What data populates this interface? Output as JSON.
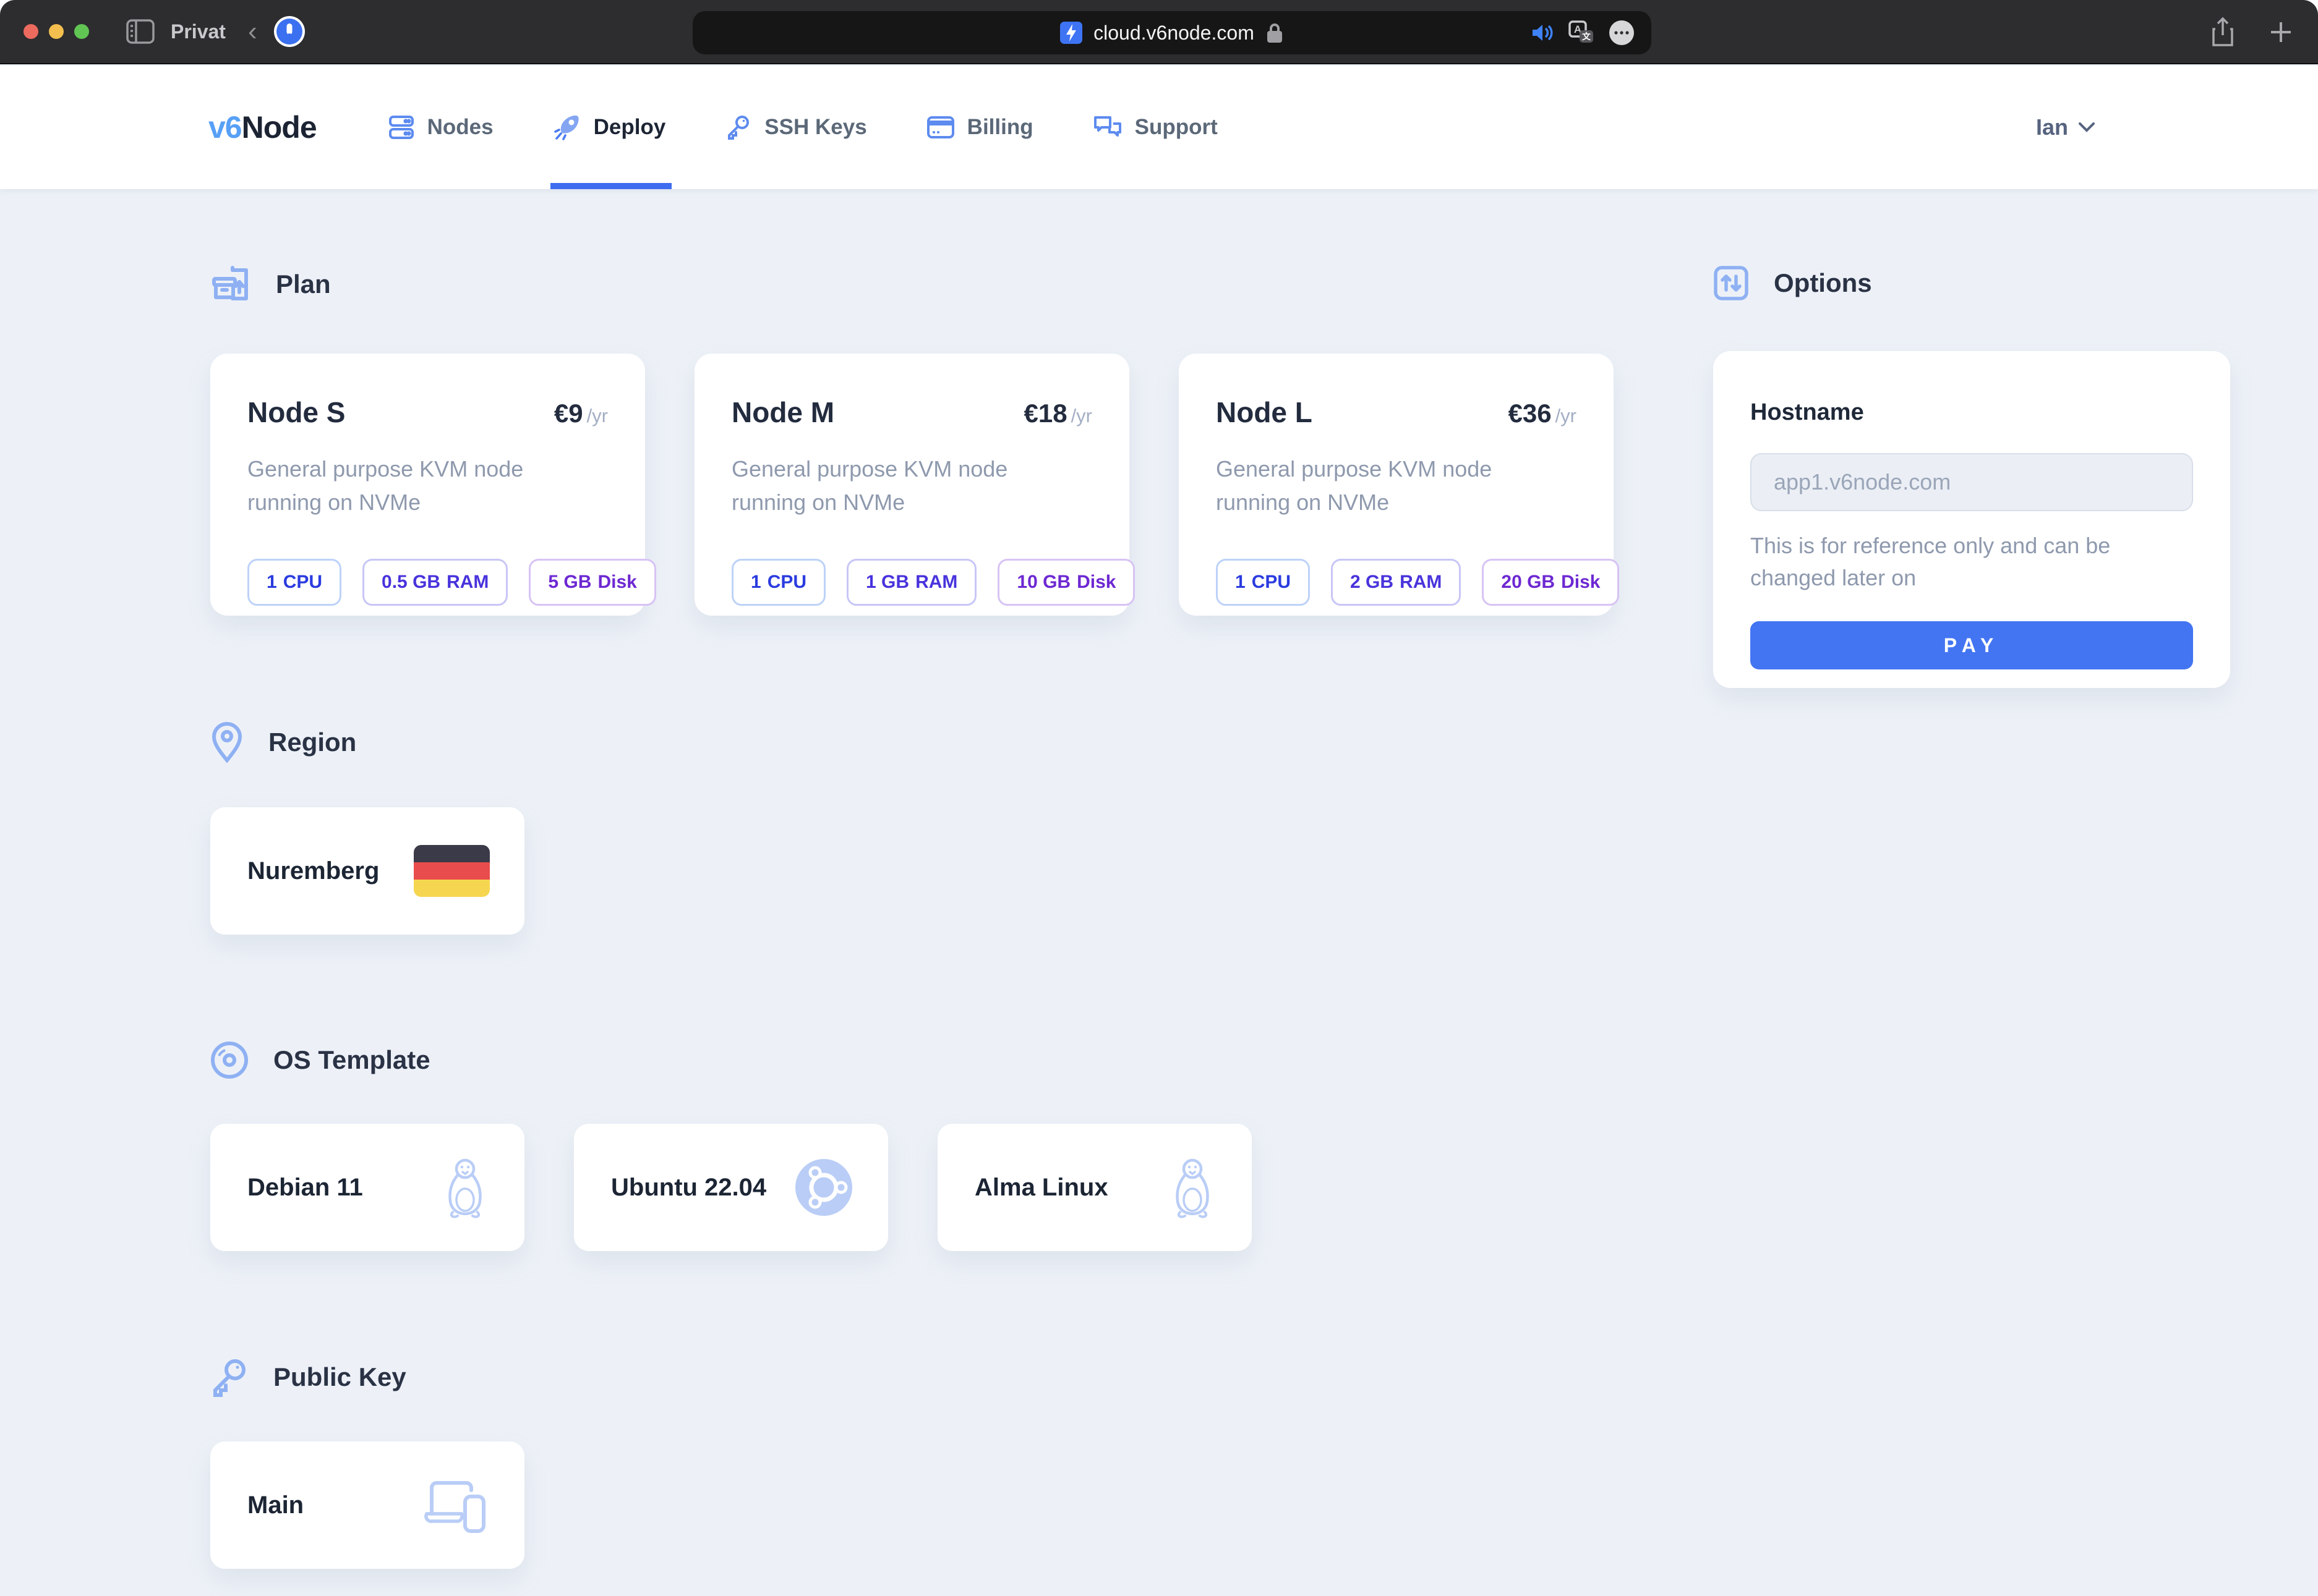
{
  "browser": {
    "window_label": "Privat",
    "url": "cloud.v6node.com",
    "icons": {
      "traffic_lights": "close / minimize / zoom",
      "sidebar_icon": "panel toggle",
      "back_icon": "‹",
      "onepassword_icon": "1Password extension",
      "favicon": "blue lightning bolt",
      "lock_icon": "padlock",
      "audio_icon": "speaker playing",
      "translate_icon": "translate bubble",
      "more_icon": "ellipsis circle",
      "share_icon": "share sheet",
      "new_tab_icon": "+"
    }
  },
  "nav": {
    "logo_prefix": "v6",
    "logo_suffix": "Node",
    "items": [
      {
        "label": "Nodes",
        "icon": "servers"
      },
      {
        "label": "Deploy",
        "icon": "rocket",
        "active": true
      },
      {
        "label": "SSH Keys",
        "icon": "key"
      },
      {
        "label": "Billing",
        "icon": "credit-card"
      },
      {
        "label": "Support",
        "icon": "chat-bubbles"
      }
    ],
    "user": {
      "name": "Ian",
      "icon": "chevron-down"
    }
  },
  "sections": {
    "plan": {
      "title": "Plan",
      "icon": "box-upload",
      "cards": [
        {
          "name": "Node S",
          "price": "€9",
          "period": "/yr",
          "description": "General purpose KVM node running on NVMe",
          "badges": [
            {
              "qty": "1",
              "unit": "CPU"
            },
            {
              "qty": "0.5 GB",
              "unit": "RAM"
            },
            {
              "qty": "5 GB",
              "unit": "Disk"
            }
          ]
        },
        {
          "name": "Node M",
          "price": "€18",
          "period": "/yr",
          "description": "General purpose KVM node running on NVMe",
          "badges": [
            {
              "qty": "1",
              "unit": "CPU"
            },
            {
              "qty": "1 GB",
              "unit": "RAM"
            },
            {
              "qty": "10 GB",
              "unit": "Disk"
            }
          ]
        },
        {
          "name": "Node L",
          "price": "€36",
          "period": "/yr",
          "description": "General purpose KVM node running on NVMe",
          "badges": [
            {
              "qty": "1",
              "unit": "CPU"
            },
            {
              "qty": "2 GB",
              "unit": "RAM"
            },
            {
              "qty": "20 GB",
              "unit": "Disk"
            }
          ]
        }
      ]
    },
    "options": {
      "title": "Options",
      "icon": "sliders",
      "hostname_label": "Hostname",
      "hostname_placeholder": "app1.v6node.com",
      "helper": "This is for reference only and can be changed later on",
      "pay_label": "PAY"
    },
    "region": {
      "title": "Region",
      "icon": "map-pin",
      "locations": [
        {
          "name": "Nuremberg",
          "flag": "germany"
        }
      ]
    },
    "os_template": {
      "title": "OS Template",
      "icon": "disc",
      "templates": [
        {
          "name": "Debian 11",
          "icon": "tux"
        },
        {
          "name": "Ubuntu 22.04",
          "icon": "ubuntu"
        },
        {
          "name": "Alma Linux",
          "icon": "tux"
        }
      ]
    },
    "public_key": {
      "title": "Public Key",
      "icon": "key",
      "keys": [
        {
          "name": "Main",
          "icon": "devices"
        }
      ]
    }
  },
  "colors": {
    "accent_blue": "#3e6df0",
    "pay_button": "#4375f2",
    "nav_icon_blue": "#5d8bef",
    "section_icon_blue": "#8fb1f3",
    "tile_icon_blue": "#b9cdf6",
    "badge_cpu_text": "#2b3cdf",
    "badge_ram_text": "#4833dc",
    "badge_disk_text": "#6d28d2",
    "heading_navy": "#2a3245",
    "body_gray": "#8e99ad",
    "page_bg": "#edf1f7",
    "chrome_bg": "#2d2d2f",
    "urlbar_bg": "#161617",
    "flag_black": "#3b3a48",
    "flag_red": "#e94c4c",
    "flag_yellow": "#f6d650"
  }
}
